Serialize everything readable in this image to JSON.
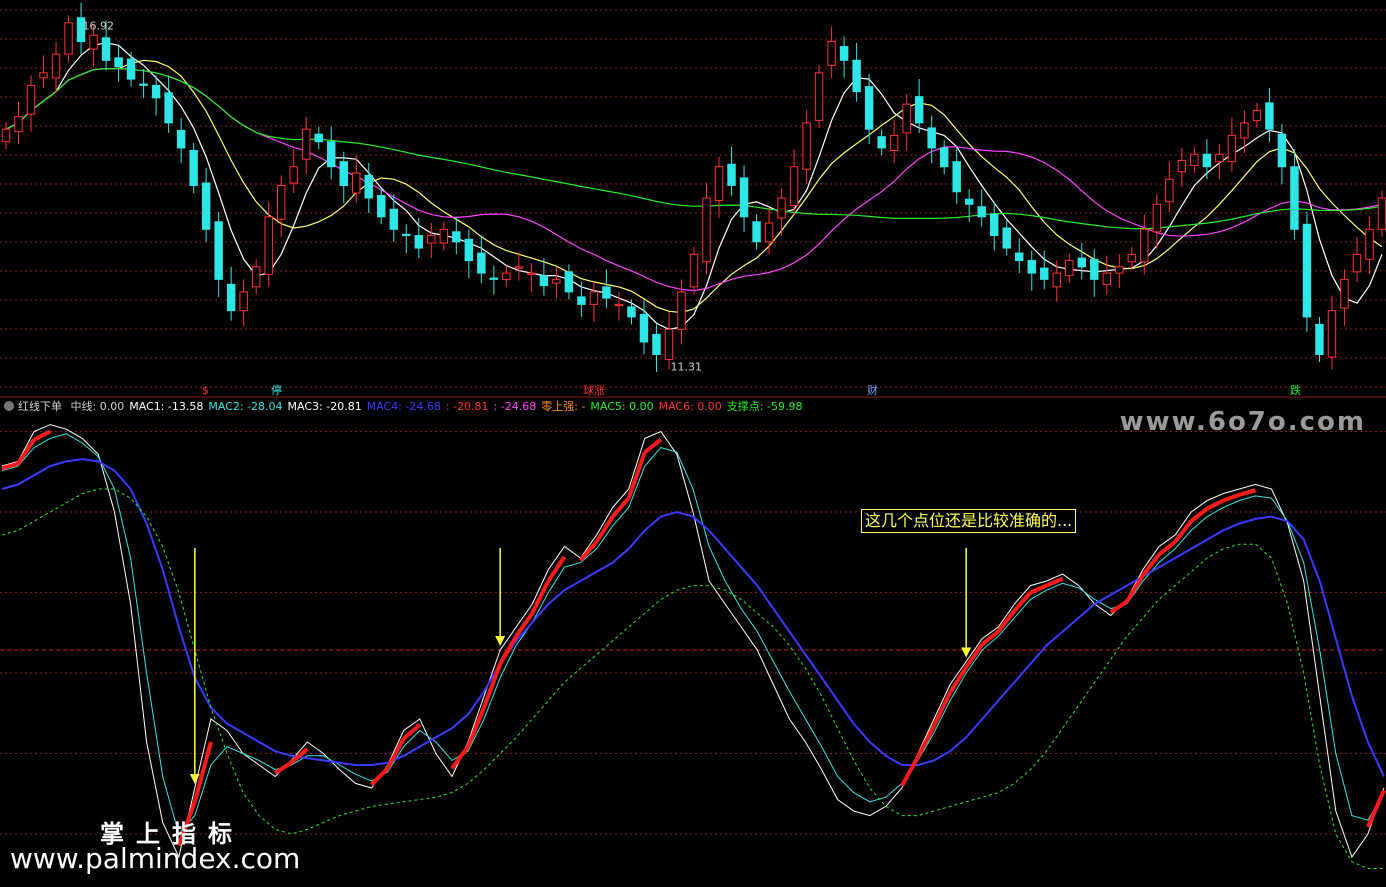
{
  "legend": {
    "indicator_name": "红线下单",
    "items": [
      {
        "label": "中线: 0.00",
        "color": "#cfcfcf"
      },
      {
        "label": "MAC1: -13.58",
        "color": "#ffffff"
      },
      {
        "label": "MAC2: -28.04",
        "color": "#2ee6e6"
      },
      {
        "label": "MAC3: -20.81",
        "color": "#ffffff"
      },
      {
        "label": "MAC4: -24.68",
        "color": "#3a3aff"
      },
      {
        "label": ": -20.81",
        "color": "#ff3030"
      },
      {
        "label": ": -24.68",
        "color": "#ff40ff"
      },
      {
        "label": "零上强: -",
        "color": "#ff8c1a"
      },
      {
        "label": "MAC5: 0.00",
        "color": "#22ee22"
      },
      {
        "label": "MAC6: 0.00",
        "color": "#ff3030"
      },
      {
        "label": "支撑点: -59.98",
        "color": "#22ee22"
      }
    ]
  },
  "price_labels": {
    "high": "16.92",
    "low": "11.31"
  },
  "markers": [
    {
      "text": "$",
      "color": "#ff3030"
    },
    {
      "text": "停",
      "color": "#2ee6e6"
    },
    {
      "text": "球涨",
      "color": "#ff3030"
    },
    {
      "text": "财",
      "color": "#6aa0ff"
    },
    {
      "text": "跌",
      "color": "#22ee22"
    }
  ],
  "annotation": "这几个点位还是比较准确的...",
  "watermarks": {
    "site_top": "www.6o7o.com",
    "brand_cn": "掌上指标",
    "site_bottom": "www.palmindex.com"
  },
  "colors": {
    "up": "#ff3030",
    "down": "#2ee6e6",
    "ma5": "#ffffff",
    "ma10": "#ffff66",
    "ma20": "#ff40ff",
    "ma60": "#22ee22",
    "grid": "#8b1a1a",
    "arrow": "#ffff33"
  },
  "chart_data": [
    {
      "type": "candlestick",
      "title": "",
      "ylim": [
        11.0,
        17.2
      ],
      "series_close": [
        15.2,
        15.4,
        15.9,
        16.1,
        16.4,
        16.9,
        16.6,
        16.7,
        16.3,
        16.2,
        16.0,
        15.9,
        15.7,
        15.3,
        14.9,
        14.3,
        13.6,
        12.8,
        12.3,
        12.6,
        13.0,
        13.8,
        14.3,
        14.6,
        15.2,
        15.0,
        14.6,
        14.3,
        14.5,
        14.1,
        13.8,
        13.6,
        13.5,
        13.3,
        13.5,
        13.6,
        13.4,
        13.1,
        12.9,
        12.8,
        12.9,
        13.0,
        12.9,
        12.7,
        12.8,
        12.6,
        12.4,
        12.6,
        12.5,
        12.4,
        12.2,
        11.8,
        11.6,
        12.0,
        12.6,
        13.2,
        14.1,
        14.6,
        14.3,
        13.8,
        13.4,
        13.7,
        14.1,
        14.6,
        15.3,
        16.1,
        16.6,
        16.3,
        15.8,
        15.2,
        14.9,
        15.1,
        15.6,
        15.3,
        14.9,
        14.6,
        14.2,
        14.0,
        13.8,
        13.5,
        13.3,
        13.1,
        12.9,
        12.8,
        12.9,
        13.1,
        13.0,
        12.8,
        12.9,
        13.0,
        13.2,
        13.6,
        14.0,
        14.4,
        14.7,
        14.8,
        14.6,
        14.8,
        15.1,
        15.3,
        15.5,
        15.2,
        14.6,
        13.6,
        12.2,
        11.6,
        12.3,
        12.8,
        13.2,
        13.6,
        14.1
      ],
      "ma_series": [
        {
          "name": "MA5",
          "period": 5
        },
        {
          "name": "MA10",
          "period": 10
        },
        {
          "name": "MA20",
          "period": 20
        },
        {
          "name": "MA60",
          "period": 60
        }
      ],
      "price_high": 16.92,
      "price_low": 11.31
    },
    {
      "type": "line",
      "title": "红线下单",
      "ylim": [
        -100,
        100
      ],
      "grid_values": [
        95,
        60,
        25,
        -10,
        -45,
        -80
      ],
      "zero_line": 0,
      "series": [
        {
          "name": "MAC1",
          "color": "#ffffff",
          "values": [
            80,
            82,
            95,
            98,
            96,
            92,
            85,
            60,
            20,
            -40,
            -75,
            -90,
            -60,
            -30,
            -35,
            -45,
            -50,
            -55,
            -48,
            -40,
            -45,
            -52,
            -58,
            -60,
            -50,
            -35,
            -30,
            -45,
            -55,
            -40,
            -20,
            0,
            10,
            20,
            35,
            45,
            40,
            50,
            62,
            70,
            92,
            95,
            85,
            60,
            30,
            20,
            10,
            0,
            -15,
            -30,
            -40,
            -52,
            -65,
            -70,
            -72,
            -68,
            -60,
            -45,
            -30,
            -15,
            -5,
            5,
            10,
            20,
            28,
            30,
            33,
            28,
            20,
            15,
            22,
            35,
            45,
            50,
            60,
            65,
            68,
            70,
            72,
            70,
            55,
            30,
            -20,
            -70,
            -90,
            -80,
            -60
          ]
        },
        {
          "name": "MAC2",
          "color": "#2ee6e6",
          "values": [
            78,
            80,
            88,
            92,
            94,
            90,
            84,
            70,
            40,
            -10,
            -55,
            -80,
            -72,
            -50,
            -42,
            -45,
            -48,
            -52,
            -50,
            -46,
            -46,
            -50,
            -54,
            -57,
            -53,
            -42,
            -35,
            -40,
            -48,
            -44,
            -30,
            -12,
            2,
            12,
            25,
            36,
            38,
            44,
            54,
            62,
            80,
            88,
            86,
            70,
            45,
            30,
            18,
            8,
            -5,
            -18,
            -30,
            -42,
            -55,
            -62,
            -66,
            -64,
            -58,
            -48,
            -36,
            -22,
            -10,
            0,
            6,
            14,
            22,
            26,
            29,
            27,
            22,
            18,
            20,
            30,
            38,
            44,
            52,
            58,
            62,
            65,
            67,
            66,
            56,
            38,
            0,
            -45,
            -72,
            -74,
            -62
          ]
        },
        {
          "name": "MAC4",
          "color": "#3a3aff",
          "values": [
            70,
            72,
            76,
            80,
            82,
            83,
            82,
            78,
            70,
            55,
            35,
            10,
            -12,
            -25,
            -32,
            -36,
            -40,
            -44,
            -46,
            -47,
            -48,
            -49,
            -50,
            -50,
            -49,
            -46,
            -42,
            -38,
            -34,
            -28,
            -18,
            -6,
            4,
            12,
            20,
            26,
            30,
            34,
            38,
            44,
            52,
            58,
            60,
            58,
            52,
            44,
            36,
            28,
            18,
            8,
            -2,
            -12,
            -22,
            -32,
            -40,
            -46,
            -50,
            -50,
            -48,
            -44,
            -38,
            -30,
            -22,
            -14,
            -6,
            2,
            8,
            14,
            20,
            24,
            28,
            32,
            36,
            40,
            44,
            48,
            52,
            55,
            57,
            58,
            56,
            48,
            30,
            5,
            -20,
            -40,
            -55
          ]
        },
        {
          "name": "支撑点",
          "color": "#22ee22",
          "values": [
            50,
            52,
            56,
            60,
            64,
            68,
            70,
            70,
            66,
            58,
            45,
            25,
            0,
            -25,
            -45,
            -62,
            -72,
            -78,
            -80,
            -78,
            -75,
            -72,
            -70,
            -68,
            -67,
            -66,
            -65,
            -64,
            -62,
            -58,
            -52,
            -45,
            -38,
            -30,
            -22,
            -14,
            -8,
            -2,
            4,
            10,
            16,
            22,
            26,
            28,
            28,
            26,
            22,
            16,
            10,
            2,
            -8,
            -20,
            -34,
            -48,
            -60,
            -68,
            -72,
            -72,
            -70,
            -68,
            -66,
            -64,
            -62,
            -58,
            -52,
            -44,
            -34,
            -24,
            -14,
            -4,
            6,
            14,
            22,
            28,
            34,
            40,
            44,
            46,
            46,
            40,
            20,
            -10,
            -50,
            -80,
            -92,
            -95,
            -95
          ]
        }
      ],
      "arrows_at": [
        12,
        31,
        60,
        90
      ]
    }
  ]
}
